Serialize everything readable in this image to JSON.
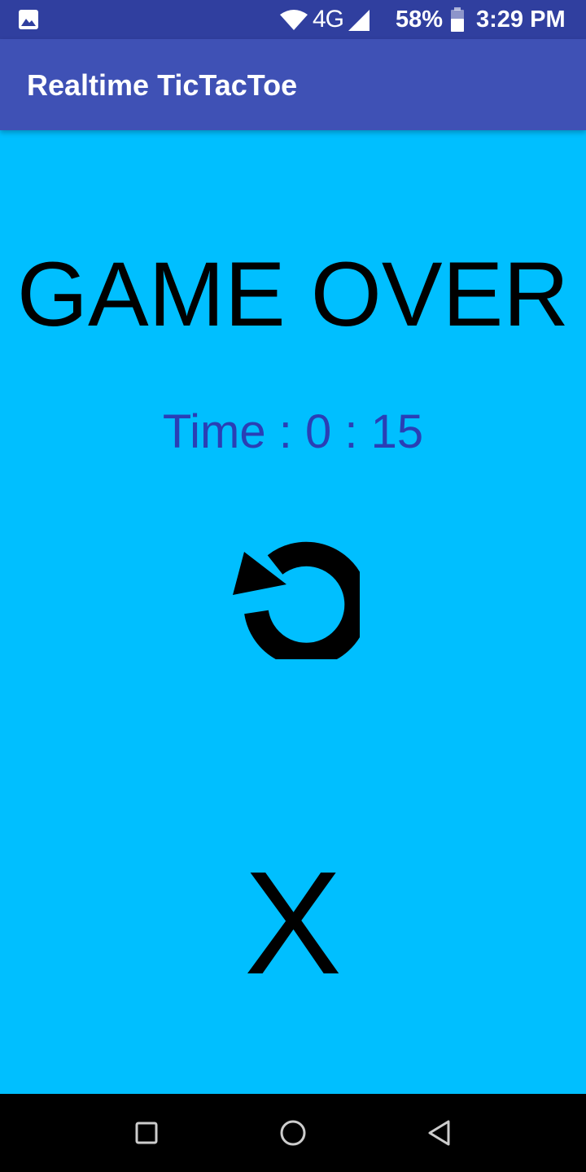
{
  "status_bar": {
    "network": "4G",
    "battery": "58%",
    "time": "3:29 PM",
    "icons": [
      "gallery-icon",
      "wifi-icon",
      "signal-icon",
      "battery-icon"
    ]
  },
  "app_bar": {
    "title": "Realtime TicTacToe"
  },
  "main": {
    "heading": "GAME OVER",
    "timer": "Time : 0 : 15",
    "restart_icon": "restart-icon",
    "winner_symbol": "X"
  },
  "nav_bar": {
    "icons": [
      "recents-icon",
      "home-icon",
      "back-icon"
    ]
  },
  "colors": {
    "status_bar": "#303F9F",
    "app_bar": "#3F51B5",
    "background": "#00BFFF",
    "timer_text": "#2A3FB5",
    "nav_bar": "#000000"
  }
}
